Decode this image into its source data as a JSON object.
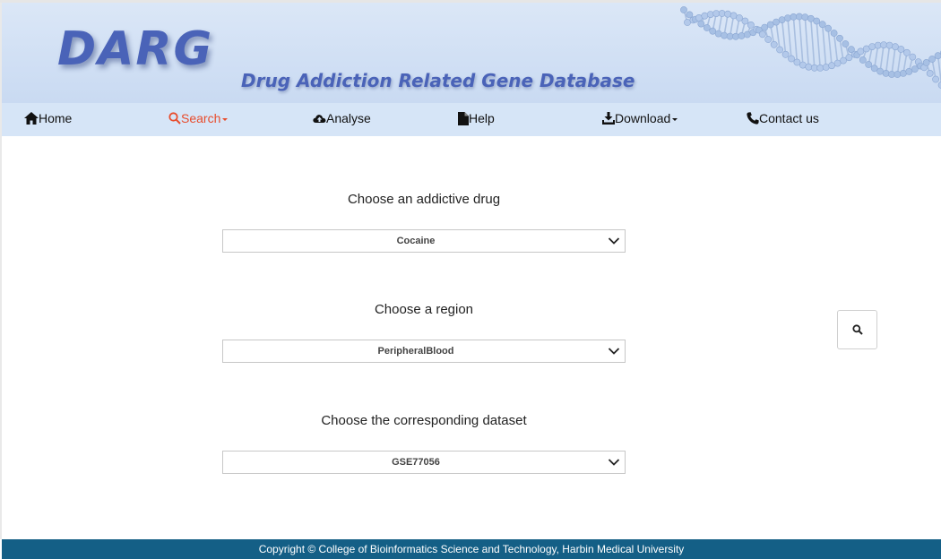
{
  "header": {
    "logo_text": "DARG",
    "subtitle": "Drug Addiction Related Gene Database"
  },
  "nav": {
    "items": [
      {
        "label": "Home",
        "icon": "home-icon"
      },
      {
        "label": "Search",
        "icon": "search-icon",
        "active": true,
        "dropdown": true
      },
      {
        "label": "Analyse",
        "icon": "cloud-upload-icon"
      },
      {
        "label": "Help",
        "icon": "file-icon"
      },
      {
        "label": "Download",
        "icon": "download-icon",
        "dropdown": true
      },
      {
        "label": "Contact us",
        "icon": "phone-icon"
      }
    ]
  },
  "form": {
    "drug": {
      "label": "Choose an addictive drug",
      "value": "Cocaine"
    },
    "region": {
      "label": "Choose a region",
      "value": "PeripheralBlood"
    },
    "dataset": {
      "label": "Choose the corresponding dataset",
      "value": "GSE77056"
    }
  },
  "search_button": {
    "icon": "search-icon"
  },
  "footer": {
    "copyright": "Copyright © College of Bioinformatics Science and Technology, Harbin Medical University"
  },
  "colors": {
    "banner": "#d3e2f5",
    "nav_bg": "#d6e5f7",
    "brand_blue": "#4a63b8",
    "active_nav": "#e84c2c",
    "footer_bg": "#145f86"
  }
}
